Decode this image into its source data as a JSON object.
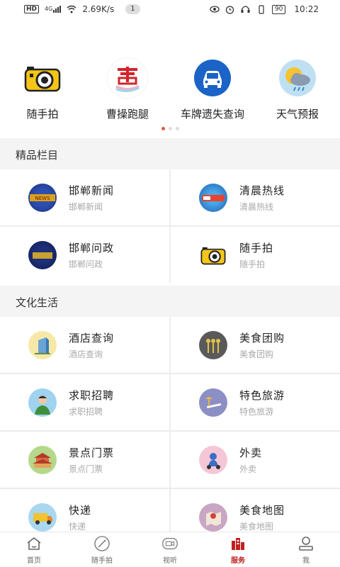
{
  "status": {
    "network_badge": "HD",
    "signal_label": "4G",
    "speed": "2.69K/s",
    "notification_count": "1",
    "battery": "90",
    "time": "10:22"
  },
  "shortcuts": [
    {
      "label": "随手拍",
      "icon": "camera-icon"
    },
    {
      "label": "曹操跑腿",
      "icon": "caocao-logo-icon"
    },
    {
      "label": "车牌遗失查询",
      "icon": "car-icon"
    },
    {
      "label": "天气预报",
      "icon": "weather-icon"
    }
  ],
  "sections": [
    {
      "title": "精品栏目",
      "items": [
        {
          "title": "邯郸新闻",
          "subtitle": "邯郸新闻",
          "icon": "news-logo-icon"
        },
        {
          "title": "清晨热线",
          "subtitle": "清晨热线",
          "icon": "hotline-logo-icon"
        },
        {
          "title": "邯郸问政",
          "subtitle": "邯郸问政",
          "icon": "politics-logo-icon"
        },
        {
          "title": "随手拍",
          "subtitle": "随手拍",
          "icon": "camera-icon"
        }
      ]
    },
    {
      "title": "文化生活",
      "items": [
        {
          "title": "酒店查询",
          "subtitle": "酒店查询",
          "icon": "hotel-icon"
        },
        {
          "title": "美食团购",
          "subtitle": "美食团购",
          "icon": "utensils-icon"
        },
        {
          "title": "求职招聘",
          "subtitle": "求职招聘",
          "icon": "job-icon"
        },
        {
          "title": "特色旅游",
          "subtitle": "特色旅游",
          "icon": "travel-icon"
        },
        {
          "title": "景点门票",
          "subtitle": "景点门票",
          "icon": "attraction-icon"
        },
        {
          "title": "外卖",
          "subtitle": "外卖",
          "icon": "delivery-icon"
        },
        {
          "title": "快递",
          "subtitle": "快递",
          "icon": "express-truck-icon"
        },
        {
          "title": "美食地图",
          "subtitle": "美食地图",
          "icon": "food-map-icon"
        }
      ]
    }
  ],
  "bottom_nav": [
    {
      "label": "首页",
      "icon": "home-icon",
      "active": false
    },
    {
      "label": "随手拍",
      "icon": "compass-icon",
      "active": false
    },
    {
      "label": "视听",
      "icon": "video-icon",
      "active": false
    },
    {
      "label": "服务",
      "icon": "service-icon",
      "active": true
    },
    {
      "label": "我",
      "icon": "user-icon",
      "active": false
    }
  ],
  "colors": {
    "accent": "#c0211f",
    "dot_active": "#e45a3b",
    "section_bg": "#f4f4f4"
  }
}
